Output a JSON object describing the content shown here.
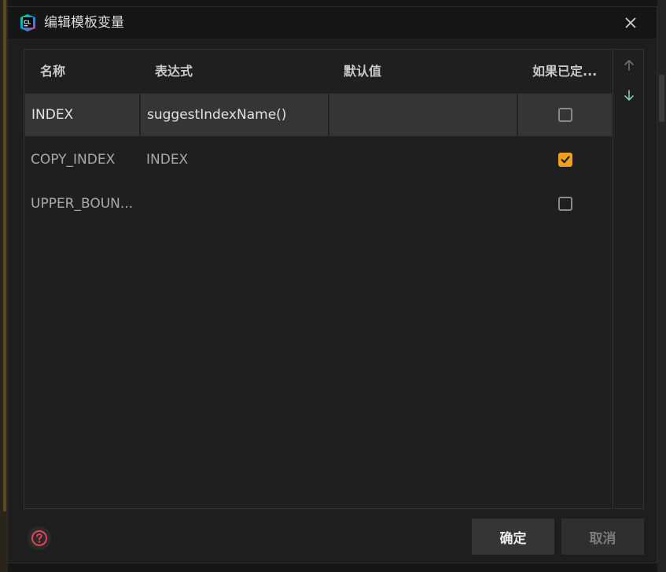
{
  "dialog": {
    "title": "编辑模板变量",
    "app_icon": "clion-logo-icon",
    "close_icon": "close-icon"
  },
  "table": {
    "columns": [
      "名称",
      "表达式",
      "默认值",
      "如果已定..."
    ],
    "rows": [
      {
        "name": "INDEX",
        "expression": "suggestIndexName()",
        "default": "",
        "skip_if_defined": false,
        "selected": true
      },
      {
        "name": "COPY_INDEX",
        "expression": "INDEX",
        "default": "",
        "skip_if_defined": true,
        "selected": false
      },
      {
        "name": "UPPER_BOUN...",
        "expression": "",
        "default": "",
        "skip_if_defined": false,
        "selected": false
      }
    ]
  },
  "tools": {
    "move_up_icon": "arrow-up-icon",
    "move_down_icon": "arrow-down-icon"
  },
  "footer": {
    "help_icon": "help-icon",
    "ok_label": "确定",
    "cancel_label": "取消"
  },
  "colors": {
    "accent_checkbox": "#f0a020",
    "help_icon": "#e0445a",
    "move_down_active": "#7fc9b8"
  }
}
